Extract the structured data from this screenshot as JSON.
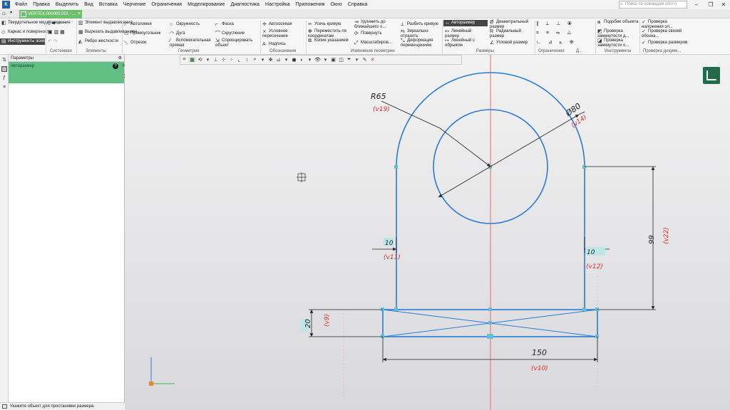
{
  "menu": [
    "Файл",
    "Правка",
    "Выделить",
    "Вид",
    "Вставка",
    "Черчение",
    "Ограничения",
    "Моделирование",
    "Диагностика",
    "Настройка",
    "Приложения",
    "Окно",
    "Справка"
  ],
  "search": {
    "placeholder": "Поиск по командам (Alt+/)"
  },
  "doc_tab": {
    "title": "VERTEX.000000.001 - ..."
  },
  "ribbon": {
    "left": [
      "Твердотельное моделирование",
      "Каркас и поверхности",
      "Инструменты эскиза"
    ],
    "elements": [
      "Элемент выдавливания",
      "Вырезать выдавливанием",
      "Ребро жесткости"
    ],
    "geometry": [
      "Автолиния",
      "Окружность",
      "Фаска",
      "Прямоугольник",
      "Дуга",
      "Скругление",
      "Отрезок",
      "Вспомогательная прямая",
      "Спроецировать объект"
    ],
    "designations": [
      "Автоосевая",
      "Условное пересечение",
      "Надпись"
    ],
    "edit": [
      "Усечь кривую",
      "Удлинить до ближайшего о...",
      "Разбить кривую",
      "Переместить по координатам",
      "Повернуть",
      "Зеркально отразить",
      "Копия указанием",
      "Масштабиров...",
      "Деформация перемещением"
    ],
    "dims": [
      "Авторазмер",
      "Диаметральный размер",
      "Линейный размер",
      "Радиальный размер",
      "Линейный с обрывом",
      "Угловой размер"
    ],
    "tools": [
      "Подобие объекта",
      "Проверка замкнутости д...",
      "Проверка замкнутости о..."
    ],
    "check": [
      "Проверка наложения эл...",
      "Проверка связей обозна...",
      "Проверка размеров"
    ],
    "groups": [
      "Системная",
      "Элементы",
      "Геометрия",
      "Обозначения",
      "Изменение геометрии",
      "Размеры",
      "Ограничения",
      "Д...",
      "Инструменты",
      "Проверка докуме..."
    ]
  },
  "panel": {
    "title": "Параметры",
    "subtitle": "Авторазмер"
  },
  "status": "Укажите объект для простановки размера",
  "drawing": {
    "r_label": "R65",
    "r_var": "(v19)",
    "d_label": "Ø80",
    "d_var": "(v14)",
    "wl_label": "10",
    "wl_var": "(v11)",
    "wr_label": "10",
    "wr_var": "(v12)",
    "h_label": "99",
    "h_var": "(v22)",
    "b_label": "20",
    "b_var": "(v9)",
    "w_label": "150",
    "w_var": "(v10)",
    "line_color": "#2a7bd5",
    "var_color": "#e03030"
  }
}
